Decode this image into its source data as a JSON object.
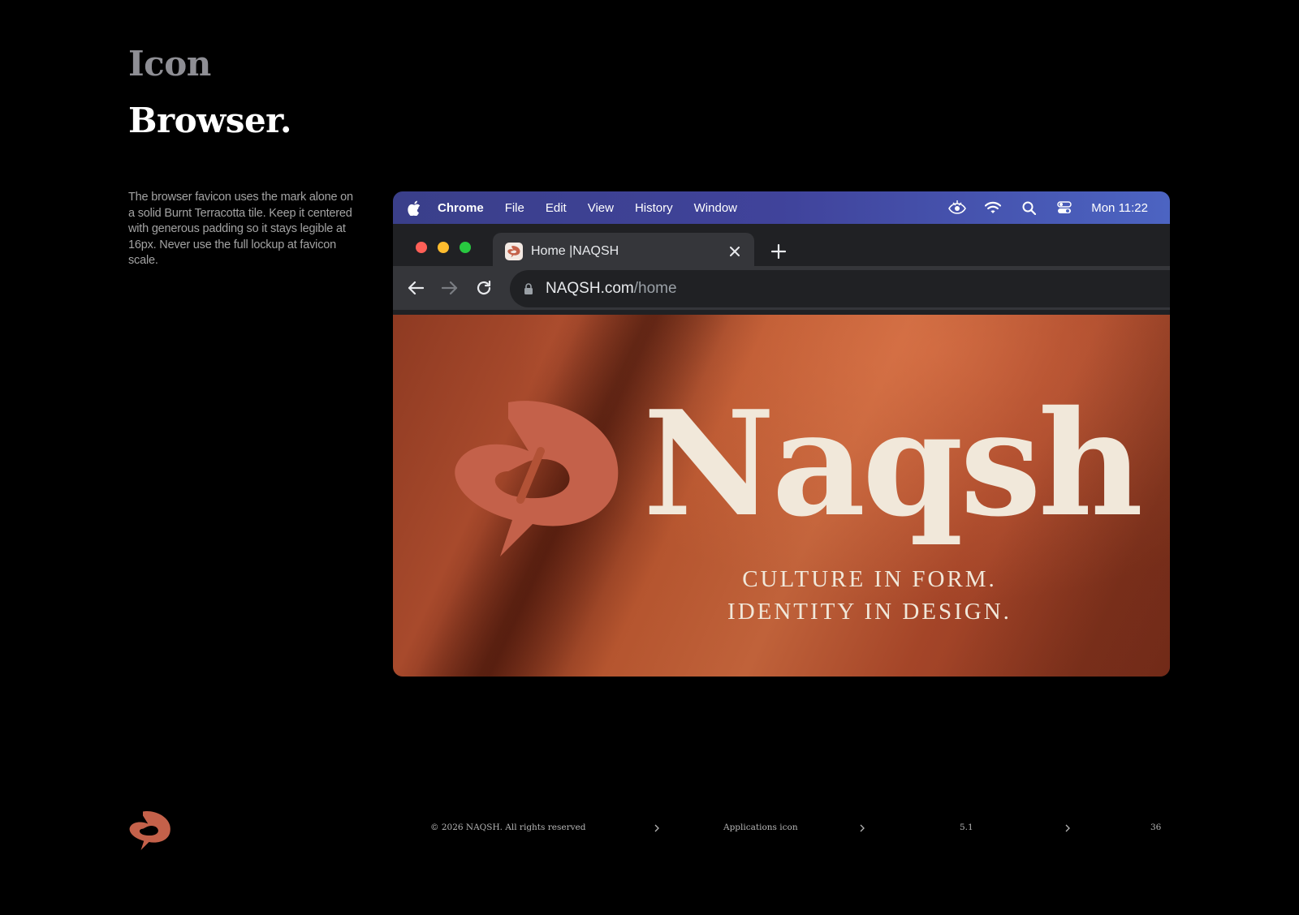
{
  "header": {
    "kicker": "Icon",
    "title": "Browser."
  },
  "description": "The browser favicon uses the mark alone on a solid Burnt Terracotta tile. Keep it centered with generous padding so it stays legible at 16px. Never use the full lockup at favicon scale.",
  "browser": {
    "menubar": {
      "app_name": "Chrome",
      "items": [
        "File",
        "Edit",
        "View",
        "History",
        "Window"
      ],
      "clock": "Mon 11:22",
      "status_icons": [
        "eye-icon",
        "wifi-icon",
        "search-icon",
        "control-center-icon"
      ]
    },
    "tab": {
      "label": "Home |NAQSH",
      "favicon": "naqsh-mark-icon"
    },
    "address": {
      "host": "NAQSH.com",
      "path": "/home"
    },
    "hero": {
      "wordmark": "Naqsh",
      "tagline_line1": "CULTURE IN FORM.",
      "tagline_line2": "IDENTITY IN DESIGN."
    }
  },
  "footer": {
    "copyright": "© 2026 NAQSH. All rights reserved",
    "section": "Applications icon",
    "number": "5.1",
    "page": "36"
  },
  "colors": {
    "terracotta": "#c4614a",
    "cream": "#f1e8da",
    "background": "#000000",
    "menubar_start": "#3a3f8a",
    "menubar_end": "#4c64c2"
  }
}
